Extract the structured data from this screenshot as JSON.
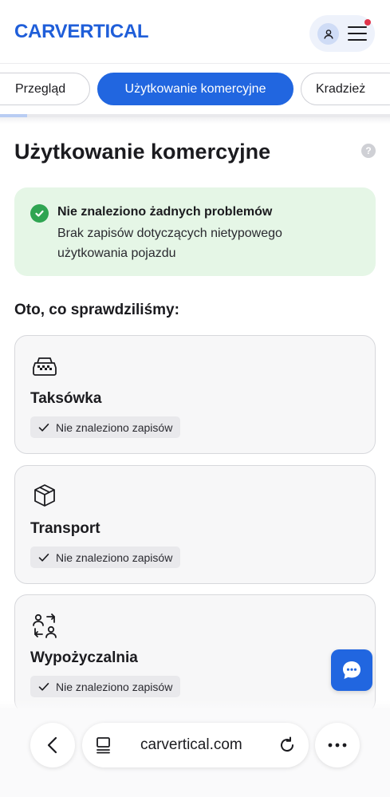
{
  "header": {
    "logo_text": "CARVERTICAL",
    "avatar_icon": "user-icon",
    "menu_icon": "hamburger-menu-icon",
    "notification_color": "#e0344b"
  },
  "tabs": {
    "items": [
      {
        "label": "Przegląd",
        "active": false
      },
      {
        "label": "Użytkowanie komercyjne",
        "active": true
      },
      {
        "label": "Kradzież",
        "active": false
      }
    ],
    "scroll_progress": 0.07
  },
  "main": {
    "title": "Użytkowanie komercyjne",
    "help_icon": "?",
    "alert": {
      "title": "Nie znaleziono żadnych problemów",
      "text": "Brak zapisów dotyczących nietypowego użytkowania pojazdu",
      "color": "#e5f6e6"
    },
    "section_label": "Oto, co sprawdziliśmy:",
    "cards": [
      {
        "title": "Taksówka",
        "icon": "taxi-icon",
        "status": "Nie znaleziono zapisów"
      },
      {
        "title": "Transport",
        "icon": "box-icon",
        "status": "Nie znaleziono zapisów"
      },
      {
        "title": "Wypożyczalnia",
        "icon": "rental-swap-icon",
        "status": "Nie znaleziono zapisów"
      }
    ]
  },
  "chat": {
    "icon": "chat-bubble-icon",
    "color": "#2166e0"
  },
  "browser": {
    "url": "carvertical.com",
    "back_icon": "chevron-left-icon",
    "tabs_icon": "tab-list-icon",
    "reload_icon": "reload-icon",
    "more_icon": "more-dots-icon"
  }
}
